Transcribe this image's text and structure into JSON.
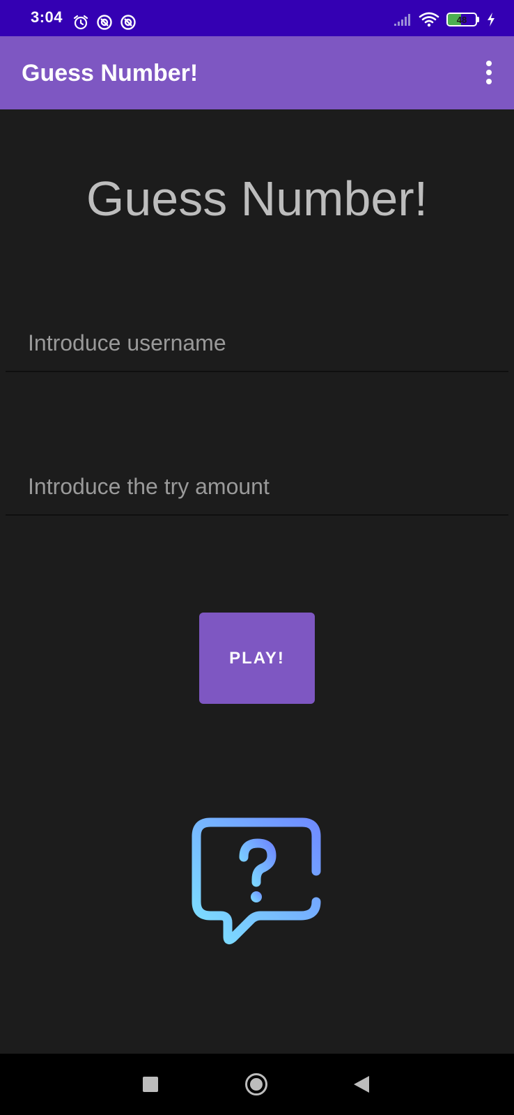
{
  "status_bar": {
    "time": "3:04",
    "battery_level": "48",
    "icons": [
      "alarm-icon",
      "sync-icon",
      "sync-icon",
      "signal-icon",
      "wifi-icon",
      "battery-icon",
      "charging-icon"
    ]
  },
  "app_bar": {
    "title": "Guess Number!",
    "menu_icon": "more-vert-icon"
  },
  "main": {
    "title": "Guess Number!",
    "username_placeholder": "Introduce username",
    "username_value": "",
    "tries_placeholder": "Introduce the try amount",
    "tries_value": "",
    "play_label": "PLAY!",
    "illustration_icon": "question-chat-bubble-icon"
  },
  "navigation_bar": {
    "icons": [
      "recents-icon",
      "home-icon",
      "back-icon"
    ]
  },
  "colors": {
    "status_bar": "#3400b3",
    "app_bar": "#7e57c2",
    "background": "#1c1c1c",
    "button": "#7e57c2",
    "title_text": "#bdbdbd",
    "hint_text": "#9a9a9a",
    "icon_gradient_start": "#7ee3ff",
    "icon_gradient_end": "#6f8cff",
    "battery_fill": "#4caf50"
  }
}
